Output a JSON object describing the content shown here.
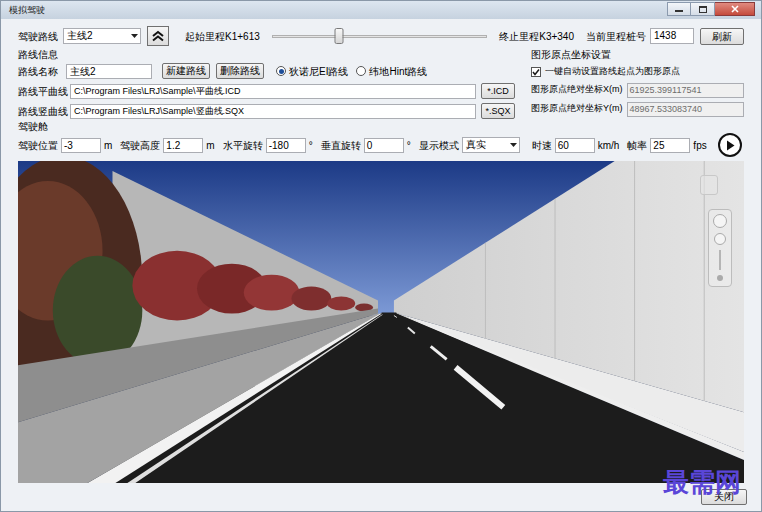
{
  "window": {
    "title": "模拟驾驶"
  },
  "route_bar": {
    "route_label": "驾驶路线",
    "route_value": "主线2",
    "start": "起始里程K1+613",
    "slider": {
      "level": 0.31
    },
    "end": "终止里程K3+340",
    "station_label": "当前里程桩号",
    "station_value": "1438",
    "refresh": "刷新"
  },
  "route_info": {
    "title": "路线信息",
    "name_label": "路线名称",
    "name_value": "主线2",
    "buttons": [
      "新建路线",
      "删除路线"
    ],
    "formats": [
      {
        "label": "狄诺尼EI路线",
        "selected": true
      },
      {
        "label": "纬地Hint路线",
        "selected": false
      }
    ],
    "plan_label": "路线平曲线",
    "plan_path": "C:\\Program Files\\LRJ\\Sample\\平曲线.ICD",
    "plan_button": "*.ICD",
    "profile_label": "路线竖曲线",
    "profile_path": "C:\\Program Files\\LRJ\\Sample\\竖曲线.SQX",
    "profile_button": "*.SQX"
  },
  "origin": {
    "title": "图形原点坐标设置",
    "auto": {
      "label": "一键自动设置路线起点为图形原点",
      "checked": true
    },
    "fields": [
      {
        "label": "图形原点绝对坐标X(m)",
        "value": "61925.399117541",
        "disabled": true
      },
      {
        "label": "图形原点绝对坐标Y(m)",
        "value": "48967.533083740",
        "disabled": true
      }
    ]
  },
  "cockpit": {
    "title": "驾驶舱",
    "fields": [
      {
        "label": "驾驶位置",
        "value": "-3",
        "unit": "m"
      },
      {
        "label": "驾驶高度",
        "value": "1.2",
        "unit": "m"
      },
      {
        "label": "水平旋转",
        "value": "-180",
        "unit": "°"
      },
      {
        "label": "垂直旋转",
        "value": "0",
        "unit": "°"
      }
    ],
    "mode_label": "显示模式",
    "mode_value": "真实",
    "speed_label": "时速",
    "speed_value": "60",
    "speed_unit": "km/h",
    "fps_label": "帧率",
    "fps_value": "25",
    "fps_unit": "fps"
  },
  "close_button": "关闭",
  "watermark": "最需网"
}
